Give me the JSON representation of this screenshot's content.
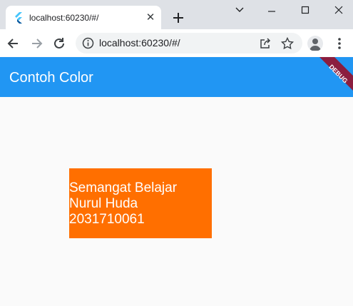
{
  "browser": {
    "tab": {
      "title": "localhost:60230/#/",
      "favicon": "flutter-icon",
      "close_glyph": "✕"
    },
    "new_tab_icon": "plus-icon",
    "window_controls": [
      "chevron-down-icon",
      "minimize-icon",
      "maximize-icon",
      "close-icon"
    ],
    "toolbar": {
      "back_icon": "arrow-left-icon",
      "forward_icon": "arrow-right-icon",
      "reload_icon": "reload-icon",
      "address": "localhost:60230/#/",
      "share_icon": "share-icon",
      "bookmark_icon": "star-icon",
      "profile_icon": "avatar-icon",
      "menu_icon": "kebab-menu-icon"
    }
  },
  "app": {
    "appbar": {
      "title": "Contoh Color",
      "color": "#2196f3"
    },
    "debug_banner": "DEBUG",
    "box": {
      "color": "#ff6f00",
      "lines": [
        "Semangat Belajar",
        "Nurul Huda",
        "2031710061"
      ]
    },
    "background": "#fafafa"
  }
}
